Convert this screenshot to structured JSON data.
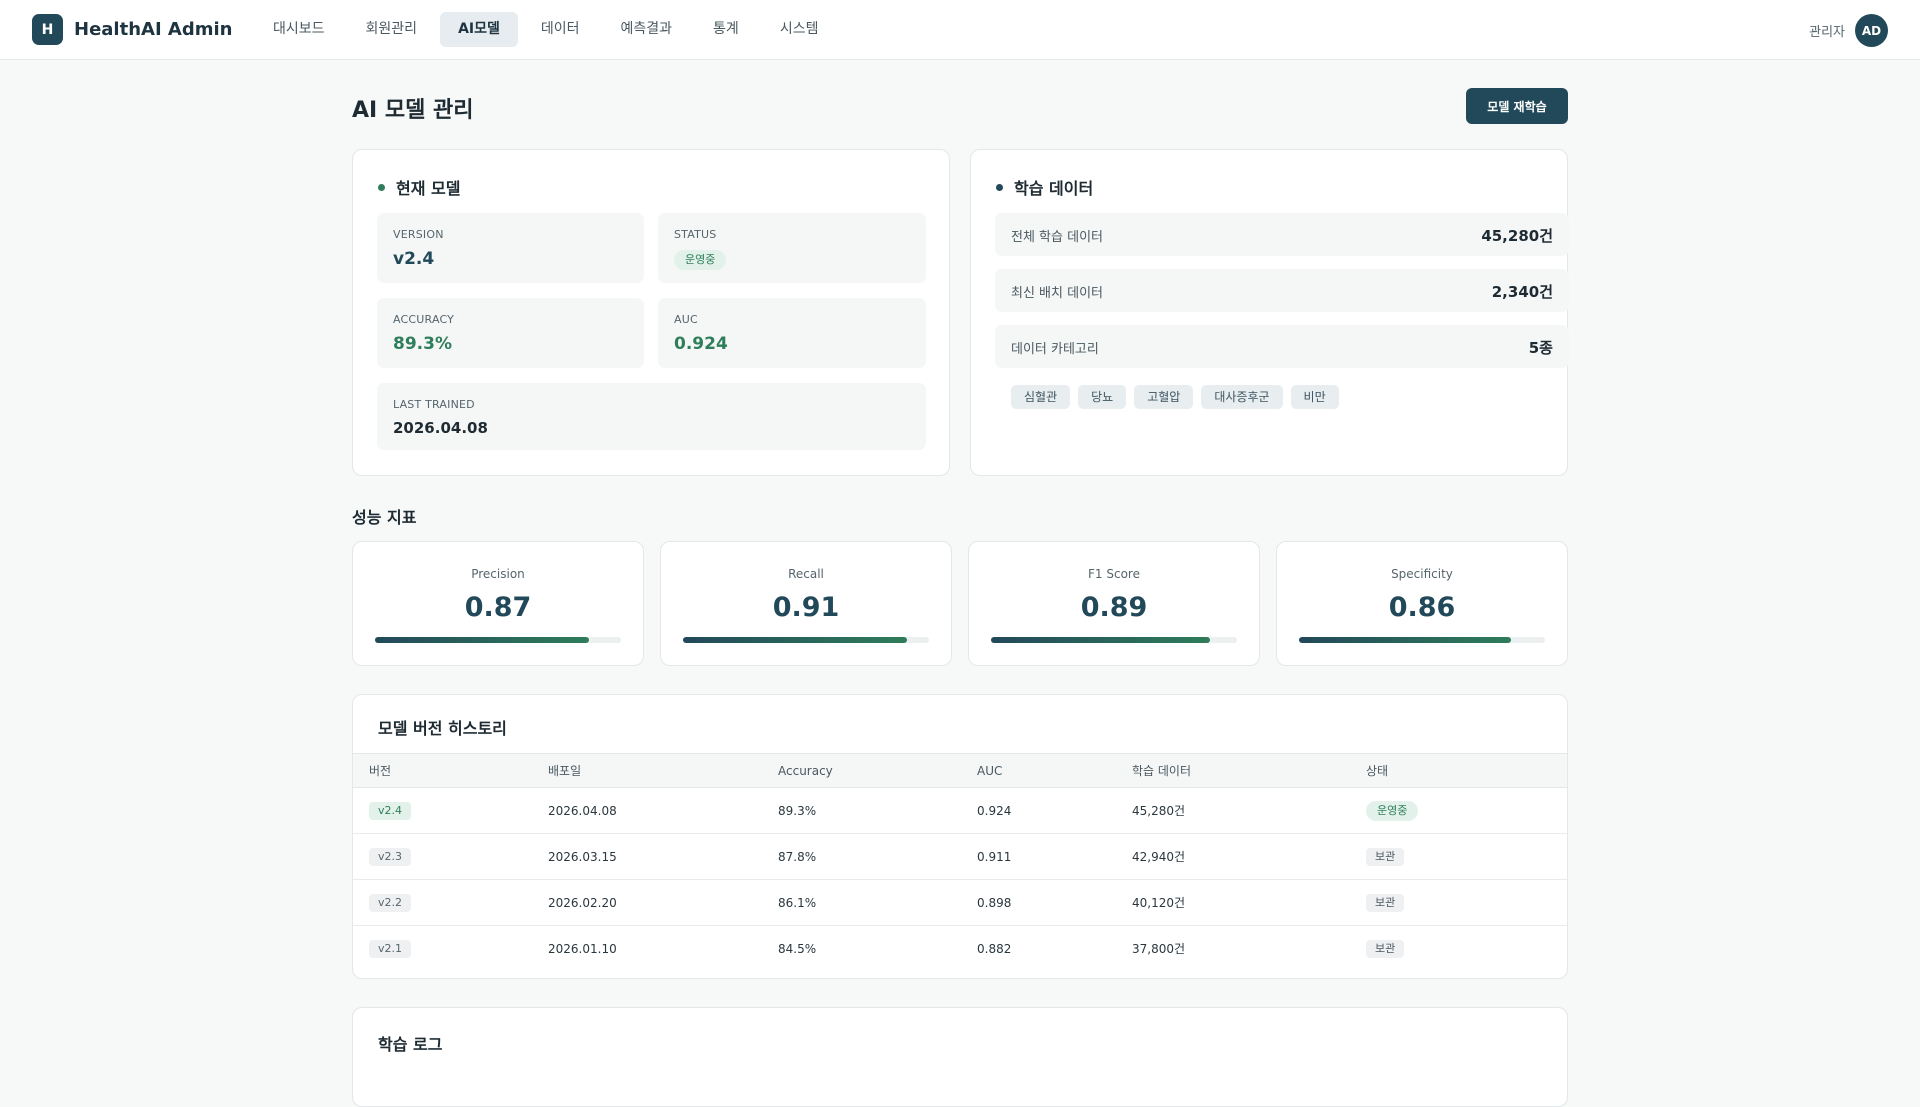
{
  "header": {
    "brand_logo": "H",
    "brand_name": "HealthAI Admin",
    "nav": [
      "대시보드",
      "회원관리",
      "AI모델",
      "데이터",
      "예측결과",
      "통계",
      "시스템"
    ],
    "active_nav": "AI모델",
    "user_label": "관리자",
    "avatar": "AD"
  },
  "page": {
    "title": "AI 모델 관리",
    "retrain_label": "모델 재학습"
  },
  "current_model": {
    "title": "현재 모델",
    "version_label": "VERSION",
    "version": "v2.4",
    "status_label": "STATUS",
    "status": "운영중",
    "accuracy_label": "ACCURACY",
    "accuracy": "89.3%",
    "auc_label": "AUC",
    "auc": "0.924",
    "last_trained_label": "LAST TRAINED",
    "last_trained": "2026.04.08"
  },
  "training_data": {
    "title": "학습 데이터",
    "rows": [
      {
        "label": "전체 학습 데이터",
        "value": "45,280건"
      },
      {
        "label": "최신 배치 데이터",
        "value": "2,340건"
      },
      {
        "label": "데이터 카테고리",
        "value": "5종"
      }
    ],
    "categories": [
      "심혈관",
      "당뇨",
      "고혈압",
      "대사증후군",
      "비만"
    ]
  },
  "metrics": {
    "title": "성능 지표",
    "items": [
      {
        "label": "Precision",
        "value": "0.87",
        "fraction": 0.87
      },
      {
        "label": "Recall",
        "value": "0.91",
        "fraction": 0.91
      },
      {
        "label": "F1 Score",
        "value": "0.89",
        "fraction": 0.89
      },
      {
        "label": "Specificity",
        "value": "0.86",
        "fraction": 0.86
      }
    ]
  },
  "history": {
    "title": "모델 버전 히스토리",
    "columns": [
      "버전",
      "배포일",
      "Accuracy",
      "AUC",
      "학습 데이터",
      "상태"
    ],
    "rows": [
      {
        "version": "v2.4",
        "date": "2026.04.08",
        "accuracy": "89.3%",
        "auc": "0.924",
        "data": "45,280건",
        "status": "운영중"
      },
      {
        "version": "v2.3",
        "date": "2026.03.15",
        "accuracy": "87.8%",
        "auc": "0.911",
        "data": "42,940건",
        "status": "보관"
      },
      {
        "version": "v2.2",
        "date": "2026.02.20",
        "accuracy": "86.1%",
        "auc": "0.898",
        "data": "40,120건",
        "status": "보관"
      },
      {
        "version": "v2.1",
        "date": "2026.01.10",
        "accuracy": "84.5%",
        "auc": "0.882",
        "data": "37,800건",
        "status": "보관"
      }
    ]
  },
  "log": {
    "title": "학습 로그"
  },
  "colors": {
    "primary": "#22495a",
    "success": "#2e7d5b",
    "background": "#f7f8f8"
  }
}
